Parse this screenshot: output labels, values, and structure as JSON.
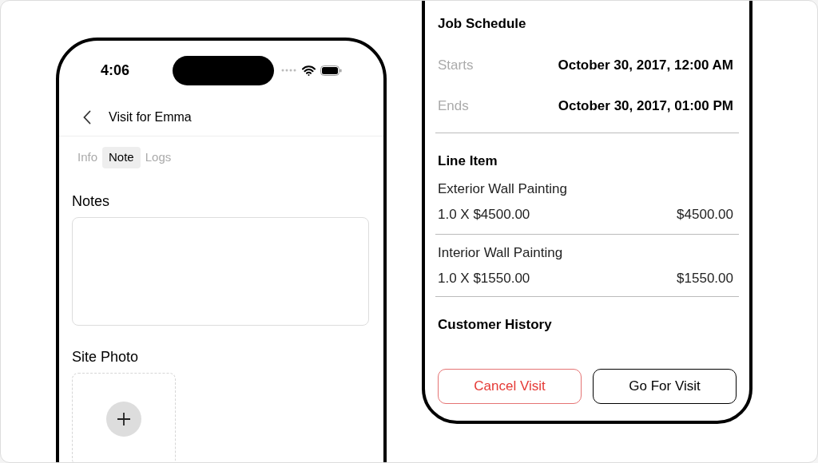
{
  "left_phone": {
    "status_bar": {
      "time": "4:06"
    },
    "header": {
      "title": "Visit for Emma"
    },
    "tabs": [
      {
        "label": "Info",
        "selected": false
      },
      {
        "label": "Note",
        "selected": true
      },
      {
        "label": "Logs",
        "selected": false
      }
    ],
    "notes": {
      "label": "Notes"
    },
    "site_photo": {
      "label": "Site Photo"
    }
  },
  "right_phone": {
    "job_schedule": {
      "title": "Job Schedule",
      "rows": [
        {
          "label": "Starts",
          "value": "October 30, 2017, 12:00 AM"
        },
        {
          "label": "Ends",
          "value": "October 30, 2017, 01:00 PM"
        }
      ]
    },
    "line_items": {
      "title": "Line Item",
      "items": [
        {
          "name": "Exterior Wall Painting",
          "quantity": "1.0 X $4500.00",
          "total": "$4500.00"
        },
        {
          "name": "Interior Wall Painting",
          "quantity": "1.0 X $1550.00",
          "total": "$1550.00"
        }
      ]
    },
    "customer_history": {
      "title": "Customer History"
    },
    "buttons": [
      {
        "label": "Cancel Visit",
        "kind": "danger"
      },
      {
        "label": "Go For Visit",
        "kind": "default"
      }
    ]
  }
}
